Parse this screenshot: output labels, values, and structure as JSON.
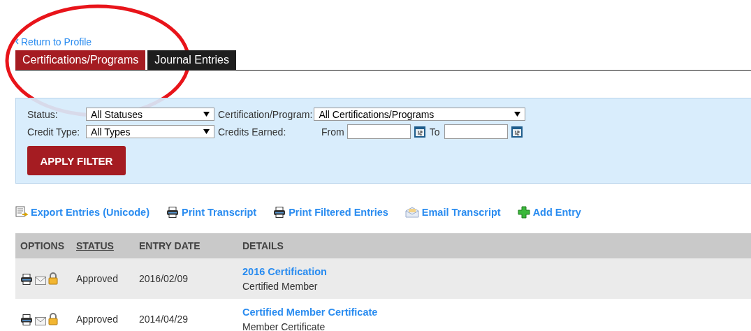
{
  "back_link": "Return to Profile",
  "tabs": [
    {
      "label": "Certifications/Programs",
      "selected": true
    },
    {
      "label": "Journal Entries",
      "selected": false
    }
  ],
  "filters": {
    "status": {
      "label": "Status:",
      "value": "All Statuses"
    },
    "program": {
      "label": "Certification/Program:",
      "value": "All Certifications/Programs"
    },
    "credit_type": {
      "label": "Credit Type:",
      "value": "All Types"
    },
    "credits_earned": {
      "label": "Credits Earned:",
      "from_label": "From",
      "to_label": "To"
    },
    "apply_button": "APPLY FILTER"
  },
  "actions": [
    {
      "kind": "export",
      "label": "Export Entries (Unicode)"
    },
    {
      "kind": "print",
      "label": "Print Transcript"
    },
    {
      "kind": "print",
      "label": "Print Filtered Entries"
    },
    {
      "kind": "email",
      "label": "Email Transcript"
    },
    {
      "kind": "add",
      "label": "Add Entry"
    }
  ],
  "table": {
    "columns": [
      {
        "label": "OPTIONS",
        "link": false
      },
      {
        "label": "STATUS",
        "link": true
      },
      {
        "label": "ENTRY DATE",
        "link": false
      },
      {
        "label": "DETAILS",
        "link": false
      }
    ],
    "rows": [
      {
        "status": "Approved",
        "entry_date": "2016/02/09",
        "title": "2016 Certification",
        "subtitle": "Certified Member"
      },
      {
        "status": "Approved",
        "entry_date": "2014/04/29",
        "title": "Certified Member Certificate",
        "subtitle": "Member Certificate"
      }
    ]
  }
}
